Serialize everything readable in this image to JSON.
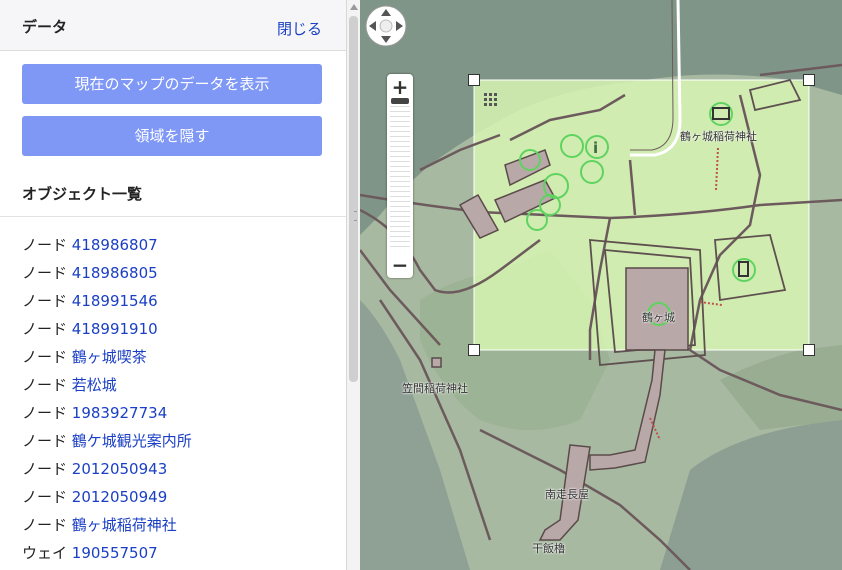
{
  "sidebar": {
    "title": "データ",
    "close_label": "閉じる",
    "show_data_button": "現在のマップのデータを表示",
    "hide_area_button": "領域を隠す",
    "objects_heading": "オブジェクト一覧",
    "objects": [
      {
        "type": "ノード",
        "name": "418986807"
      },
      {
        "type": "ノード",
        "name": "418986805"
      },
      {
        "type": "ノード",
        "name": "418991546"
      },
      {
        "type": "ノード",
        "name": "418991910"
      },
      {
        "type": "ノード",
        "name": "鶴ヶ城喫茶"
      },
      {
        "type": "ノード",
        "name": "若松城"
      },
      {
        "type": "ノード",
        "name": "1983927734"
      },
      {
        "type": "ノード",
        "name": "鶴ケ城観光案内所"
      },
      {
        "type": "ノード",
        "name": "2012050943"
      },
      {
        "type": "ノード",
        "name": "2012050949"
      },
      {
        "type": "ノード",
        "name": "鶴ヶ城稲荷神社"
      },
      {
        "type": "ウェイ",
        "name": "190557507"
      }
    ]
  },
  "map": {
    "zoom_in": "+",
    "zoom_out": "−",
    "labels": {
      "shrine": "鶴ヶ城稲荷神社",
      "castle": "鶴ヶ城",
      "inari": "笠間稲荷神社",
      "nagaya": "南走長屋",
      "bridge": "干飯櫓"
    },
    "colors": {
      "water": "#7f9587",
      "land": "#a7b9a1",
      "selection": "#d7f5b3",
      "road": "#6c5a5d",
      "building": "#b8a8a8"
    }
  }
}
